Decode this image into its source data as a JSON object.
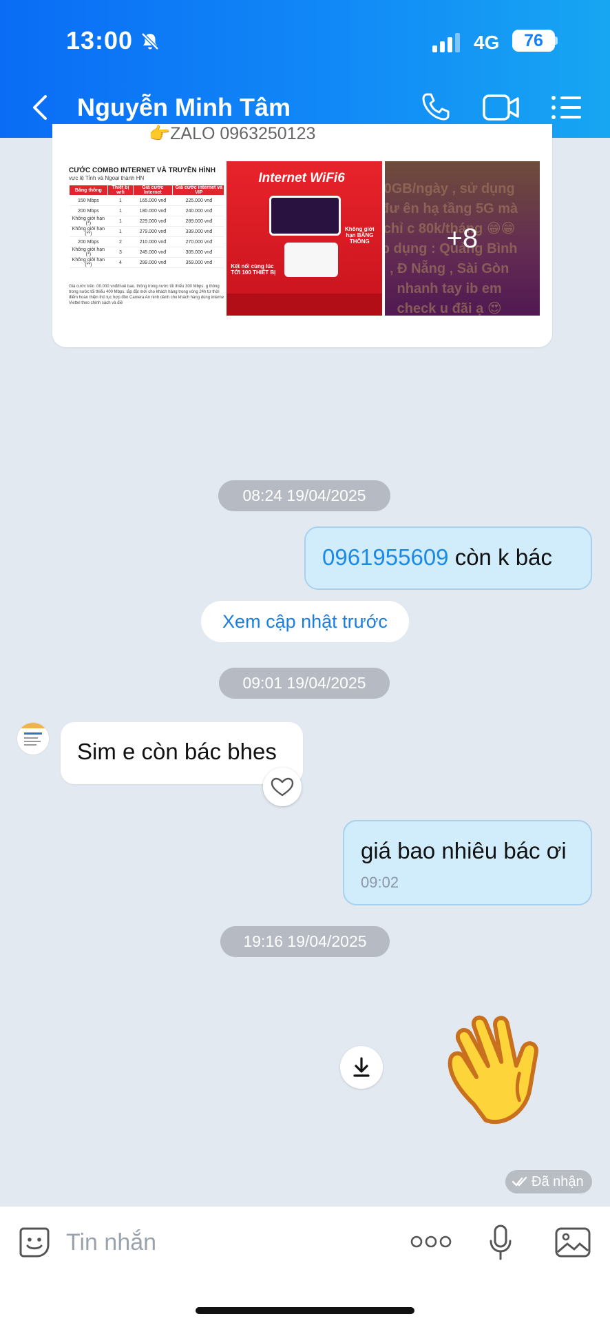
{
  "status_bar": {
    "time": "13:00",
    "network": "4G",
    "battery": "76"
  },
  "header": {
    "contact_name": "Nguyễn Minh Tâm"
  },
  "media_card": {
    "zalo_line": "👉ZALO 0963250123",
    "table_thumb": {
      "title": "CƯỚC COMBO INTERNET VÀ TRUYỀN HÌNH",
      "subtitle": "vực lệ Tỉnh và Ngoại thành HN",
      "headers": [
        "Băng thông",
        "Thiết bị wifi",
        "Giá cước Internet",
        "Giá cước internet và VIP"
      ],
      "rows": [
        [
          "150 Mbps",
          "1",
          "165.000 vnđ",
          "225.000 vnđ"
        ],
        [
          "200 Mbps",
          "1",
          "180.000 vnđ",
          "240.000 vnđ"
        ],
        [
          "Không giới hạn (*)",
          "1",
          "229.000 vnđ",
          "289.000 vnđ"
        ],
        [
          "Không giới hạn (**)",
          "1",
          "279.000 vnđ",
          "339.000 vnđ"
        ],
        [
          "200 Mbps",
          "2",
          "210.000 vnđ",
          "270.000 vnđ"
        ],
        [
          "Không giới hạn (*)",
          "3",
          "245.000 vnđ",
          "305.000 vnđ"
        ],
        [
          "Không giới hạn (**)",
          "4",
          "299.000 vnđ",
          "359.000 vnđ"
        ]
      ],
      "note": "Giá cước trên .00.000 vnđ/thuê bao. thông trong nước tối thiểu 300 Mbps. g thông trong nước tối thiểu 400 Mbps. lắp đặt mới cho khách hàng trong vòng 24h từ thời điểm hoàn thiện thủ tục hợp đồn Camera An ninh dành cho khách hàng dùng internet Viettel theo chính sách và điề"
    },
    "wifi_thumb": {
      "title": "Internet WiFi6",
      "badge": "Không giới hạn BĂNG THÔNG",
      "connect": "Kết nối cùng lúc TỚI 100 THIẾT BỊ"
    },
    "more_thumb": {
      "overlay_text": "0GB/ngày , sử dụng đư ên hạ tầng 5G mà chỉ c 80k/tháng 😁😁 p dụng : Quảng Bình , Đ Nẵng , Sài Gòn nhanh tay ib em check u đãi ạ 😍",
      "count": "+8"
    }
  },
  "messages": {
    "ts1": "08:24 19/04/2025",
    "out1_phone": "0961955609",
    "out1_text": " còn k bác",
    "update_button": "Xem cập nhật trước",
    "ts2": "09:01 19/04/2025",
    "in1_text": "Sim e còn bác bhes",
    "out2_text": "giá bao nhiêu bác ơi",
    "out2_time": "09:02",
    "ts3": "19:16 19/04/2025",
    "status": "Đã nhận"
  },
  "input_bar": {
    "placeholder": "Tin nhắn"
  },
  "colors": {
    "header_start": "#0a6cf5",
    "header_end": "#17a6f2",
    "bubble_out": "#d1ecfb",
    "link": "#1a8ae6",
    "chat_bg": "#e3e9f1"
  }
}
